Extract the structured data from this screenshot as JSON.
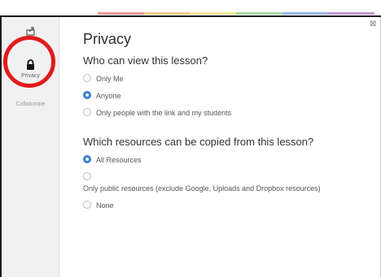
{
  "header": {
    "accent_colors": [
      "#e8443a",
      "#f3a227",
      "#f6d83b",
      "#5cb85c",
      "#3a7fd5",
      "#8e44ad"
    ]
  },
  "sidebar": {
    "items": [
      {
        "label": "",
        "icon": "share-icon"
      },
      {
        "label": "Privacy",
        "icon": "lock-icon"
      },
      {
        "label": "Collaborate",
        "icon": "collaborate-icon"
      }
    ]
  },
  "annotation": {
    "color": "#e21b1b"
  },
  "main": {
    "title": "Privacy",
    "view_question": "Who can view this lesson?",
    "view_options": [
      {
        "label": "Only Me",
        "checked": false
      },
      {
        "label": "Anyone",
        "checked": true
      },
      {
        "label": "Only people with the link and my students",
        "checked": false
      }
    ],
    "copy_question": "Which resources can be copied from this lesson?",
    "copy_options": [
      {
        "label": "All Resources",
        "checked": true
      },
      {
        "label": "Only public resources (exclude Google, Uploads and Dropbox resources)",
        "checked": false
      },
      {
        "label": "None",
        "checked": false
      }
    ]
  },
  "close": {
    "icon": "close-icon",
    "glyph": "⊠"
  }
}
